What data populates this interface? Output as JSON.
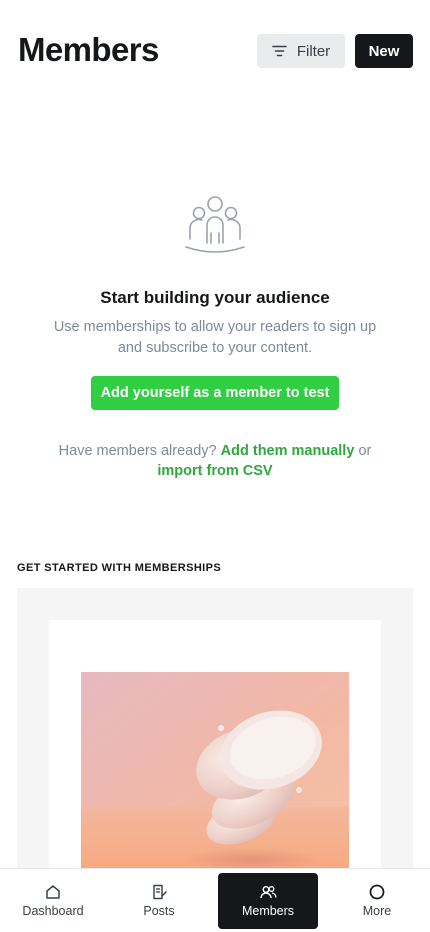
{
  "header": {
    "title": "Members",
    "filter_label": "Filter",
    "new_label": "New"
  },
  "empty_state": {
    "title": "Start building your audience",
    "description": "Use memberships to allow your readers to sign up and subscribe to your content.",
    "add_self_label": "Add yourself as a member to test",
    "import_prefix": "Have members already?",
    "add_manually_label": "Add them manually",
    "or_text": "or",
    "import_csv_label": "import from CSV"
  },
  "get_started": {
    "heading": "GET STARTED WITH MEMBERSHIPS"
  },
  "bottom_nav": {
    "items": [
      {
        "label": "Dashboard",
        "icon": "home-icon"
      },
      {
        "label": "Posts",
        "icon": "posts-icon"
      },
      {
        "label": "Members",
        "icon": "members-icon",
        "active": true
      },
      {
        "label": "More",
        "icon": "more-circle-icon"
      }
    ]
  },
  "colors": {
    "accent_green": "#30cf43",
    "link_green": "#30a83e",
    "dark": "#15171a",
    "muted_text": "#7c8b9a"
  }
}
